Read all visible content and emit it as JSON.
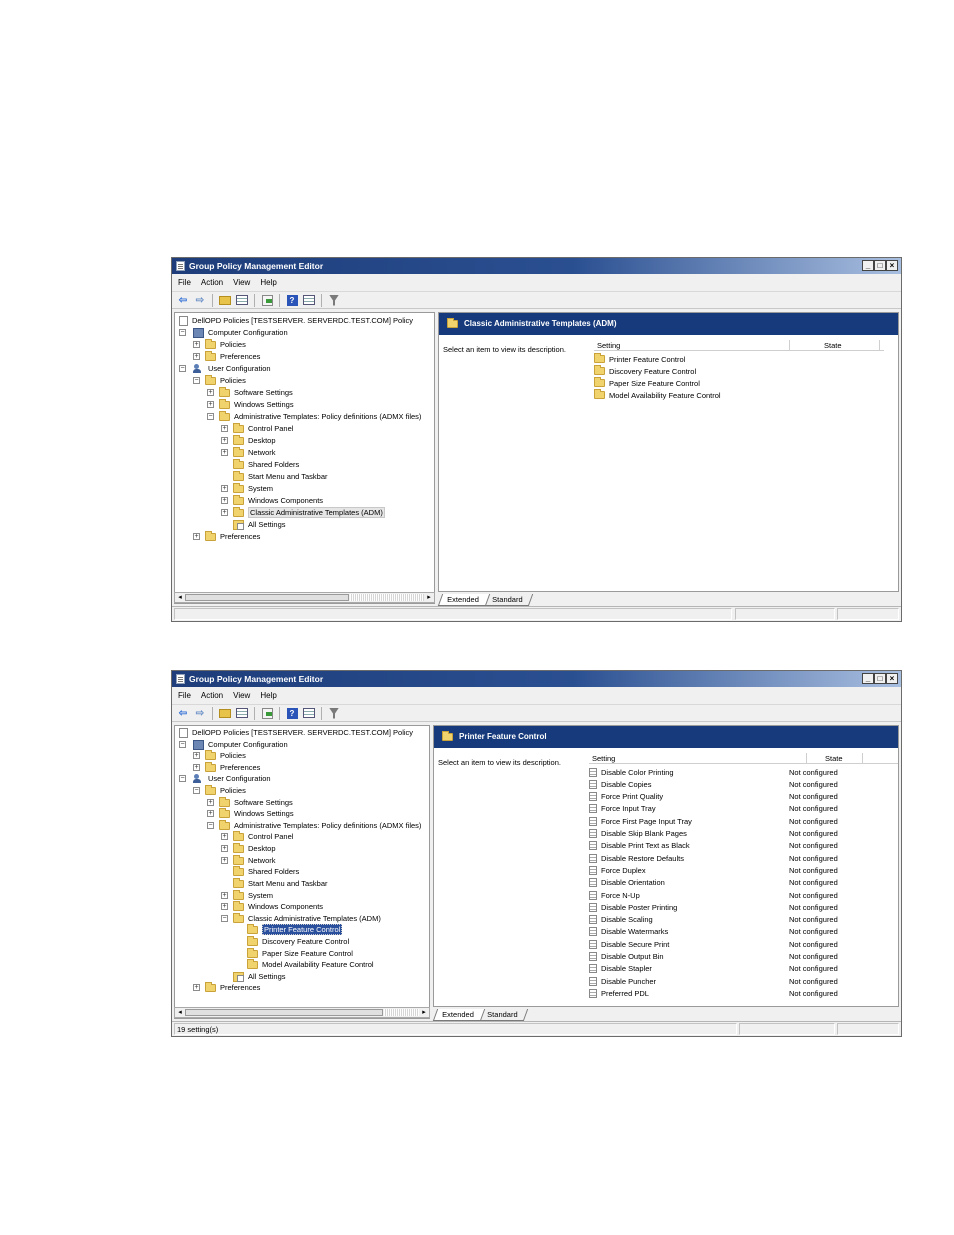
{
  "window1": {
    "title": "Group Policy Management Editor",
    "menu": [
      "File",
      "Action",
      "View",
      "Help"
    ],
    "tree": [
      {
        "label": "DellOPD Policies [TESTSERVER. SERVERDC.TEST.COM] Policy"
      },
      {
        "label": "Computer Configuration"
      },
      {
        "label": "Policies"
      },
      {
        "label": "Preferences"
      },
      {
        "label": "User Configuration"
      },
      {
        "label": "Policies"
      },
      {
        "label": "Software Settings"
      },
      {
        "label": "Windows Settings"
      },
      {
        "label": "Administrative Templates: Policy definitions (ADMX files)"
      },
      {
        "label": "Control Panel"
      },
      {
        "label": "Desktop"
      },
      {
        "label": "Network"
      },
      {
        "label": "Shared Folders"
      },
      {
        "label": "Start Menu and Taskbar"
      },
      {
        "label": "System"
      },
      {
        "label": "Windows Components"
      },
      {
        "label": "Classic Administrative Templates (ADM)"
      },
      {
        "label": "All Settings"
      },
      {
        "label": "Preferences"
      }
    ],
    "header_title": "Classic Administrative Templates (ADM)",
    "description": "Select an item to view its description.",
    "columns": {
      "setting": "Setting",
      "state": "State"
    },
    "items": [
      "Printer Feature Control",
      "Discovery Feature Control",
      "Paper Size Feature Control",
      "Model Availability Feature Control"
    ],
    "tabs": [
      "Extended",
      "Standard"
    ],
    "status": ""
  },
  "window2": {
    "title": "Group Policy Management Editor",
    "menu": [
      "File",
      "Action",
      "View",
      "Help"
    ],
    "tree": [
      {
        "label": "DellOPD Policies [TESTSERVER. SERVERDC.TEST.COM] Policy"
      },
      {
        "label": "Computer Configuration"
      },
      {
        "label": "Policies"
      },
      {
        "label": "Preferences"
      },
      {
        "label": "User Configuration"
      },
      {
        "label": "Policies"
      },
      {
        "label": "Software Settings"
      },
      {
        "label": "Windows Settings"
      },
      {
        "label": "Administrative Templates: Policy definitions (ADMX files)"
      },
      {
        "label": "Control Panel"
      },
      {
        "label": "Desktop"
      },
      {
        "label": "Network"
      },
      {
        "label": "Shared Folders"
      },
      {
        "label": "Start Menu and Taskbar"
      },
      {
        "label": "System"
      },
      {
        "label": "Windows Components"
      },
      {
        "label": "Classic Administrative Templates (ADM)"
      },
      {
        "label": "Printer Feature Control"
      },
      {
        "label": "Discovery Feature Control"
      },
      {
        "label": "Paper Size Feature Control"
      },
      {
        "label": "Model Availability Feature Control"
      },
      {
        "label": "All Settings"
      },
      {
        "label": "Preferences"
      }
    ],
    "header_title": "Printer Feature Control",
    "description": "Select an item to view its description.",
    "columns": {
      "setting": "Setting",
      "state": "State"
    },
    "settings": [
      {
        "name": "Disable Color Printing",
        "state": "Not configured"
      },
      {
        "name": "Disable Copies",
        "state": "Not configured"
      },
      {
        "name": "Force Print Quality",
        "state": "Not configured"
      },
      {
        "name": "Force Input Tray",
        "state": "Not configured"
      },
      {
        "name": "Force First Page Input Tray",
        "state": "Not configured"
      },
      {
        "name": "Disable Skip Blank Pages",
        "state": "Not configured"
      },
      {
        "name": "Disable Print Text as Black",
        "state": "Not configured"
      },
      {
        "name": "Disable Restore Defaults",
        "state": "Not configured"
      },
      {
        "name": "Force Duplex",
        "state": "Not configured"
      },
      {
        "name": "Disable Orientation",
        "state": "Not configured"
      },
      {
        "name": "Force N-Up",
        "state": "Not configured"
      },
      {
        "name": "Disable Poster Printing",
        "state": "Not configured"
      },
      {
        "name": "Disable Scaling",
        "state": "Not configured"
      },
      {
        "name": "Disable Watermarks",
        "state": "Not configured"
      },
      {
        "name": "Disable Secure Print",
        "state": "Not configured"
      },
      {
        "name": "Disable Output Bin",
        "state": "Not configured"
      },
      {
        "name": "Disable Stapler",
        "state": "Not configured"
      },
      {
        "name": "Disable Puncher",
        "state": "Not configured"
      },
      {
        "name": "Preferred PDL",
        "state": "Not configured"
      }
    ],
    "tabs": [
      "Extended",
      "Standard"
    ],
    "status": "19 setting(s)"
  },
  "icons": {
    "back": "back-arrow-icon",
    "forward": "forward-arrow-icon",
    "up": "up-one-level-icon",
    "show_hide_tree": "show-hide-console-tree-icon",
    "export": "export-list-icon",
    "help": "help-icon",
    "properties": "properties-icon",
    "filter": "filter-icon"
  },
  "colors": {
    "titlebar": "#1e3d7a",
    "header": "#163a7c",
    "selection": "#2a4f9c",
    "folder": "#f1d36d"
  }
}
